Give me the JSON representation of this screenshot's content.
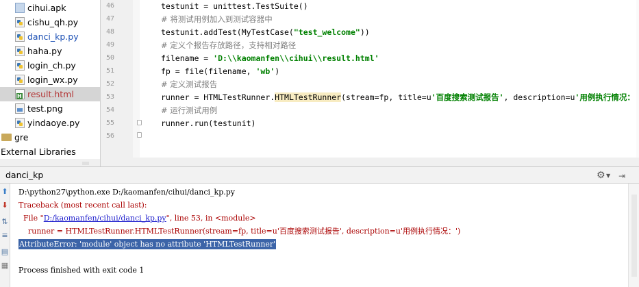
{
  "project_tree": {
    "items": [
      {
        "label": "cihui.apk",
        "icon": "apk-file-icon",
        "style": "",
        "selected": false
      },
      {
        "label": "cishu_qh.py",
        "icon": "python-file-icon",
        "style": "",
        "selected": false
      },
      {
        "label": "danci_kp.py",
        "icon": "python-file-icon",
        "style": "blue",
        "selected": false
      },
      {
        "label": "haha.py",
        "icon": "python-file-icon",
        "style": "",
        "selected": false
      },
      {
        "label": "login_ch.py",
        "icon": "python-file-icon",
        "style": "",
        "selected": false
      },
      {
        "label": "login_wx.py",
        "icon": "python-file-icon",
        "style": "",
        "selected": false
      },
      {
        "label": "result.html",
        "icon": "html-file-icon",
        "style": "red",
        "selected": true
      },
      {
        "label": "test.png",
        "icon": "image-file-icon",
        "style": "",
        "selected": false
      },
      {
        "label": "yindaoye.py",
        "icon": "python-file-icon",
        "style": "",
        "selected": false
      },
      {
        "label": "gre",
        "icon": "folder-icon",
        "style": "",
        "selected": false
      },
      {
        "label": "External Libraries",
        "icon": "library-icon",
        "style": "",
        "selected": false
      }
    ]
  },
  "editor": {
    "line_numbers": [
      "46",
      "47",
      "48",
      "49",
      "50",
      "51",
      "52",
      "53",
      "54",
      "55",
      "56"
    ],
    "code": {
      "l46": "testunit = unittest.TestSuite()",
      "l47": "# 将测试用例加入到测试容器中",
      "l48_a": "testunit.addTest(MyTestCase(",
      "l48_b": "\"test_welcome\"",
      "l48_c": "))",
      "l49": "# 定义个报告存放路径，支持相对路径",
      "l50_a": "filename = ",
      "l50_b": "'D:\\\\kaomanfen\\\\cihui\\\\result.html'",
      "l51_a": "fp = file(filename, ",
      "l51_b": "'wb'",
      "l51_c": ")",
      "l52": "# 定义测试报告",
      "l53_a": "runner = HTMLTestRunner.",
      "l53_b": "HTMLTestRunner",
      "l53_c": "(stream=fp, title=u",
      "l53_d": "'百度搜索测试报告'",
      "l53_e": ", description=u",
      "l53_f": "'用例执行情况：'",
      "l53_g": ")",
      "l54": "# 运行测试用例",
      "l55": "runner.run(testunit)"
    }
  },
  "run_panel": {
    "title": "danci_kp",
    "toolbar_icons": [
      "rerun-icon",
      "stop-icon",
      "soft-wrap-icon",
      "scroll-to-end-icon",
      "print-icon",
      "clear-icon"
    ],
    "console": {
      "cmd": "D:\\python27\\python.exe D:/kaomanfen/cihui/danci_kp.py",
      "traceback": "Traceback (most recent call last):",
      "file_prefix": "  File \"",
      "file_link": "D:/kaomanfen/cihui/danci_kp.py",
      "file_suffix": "\", line 53, in <module>",
      "code_line": "    runner = HTMLTestRunner.HTMLTestRunner(stream=fp, title=u'百度搜索测试报告', description=u'用例执行情况：')",
      "error": "AttributeError: 'module' object has no attribute 'HTMLTestRunner'",
      "exit": "Process finished with exit code 1"
    }
  },
  "colors": {
    "selection": "#3c64a8",
    "error_text": "#aa0000",
    "link": "#1a1acc",
    "comment": "#808080",
    "string": "#008000"
  }
}
